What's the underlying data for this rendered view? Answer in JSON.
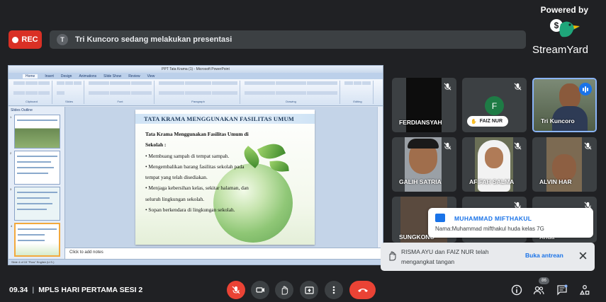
{
  "branding": {
    "powered_by": "Powered by",
    "logo_text": "StreamYard"
  },
  "recording": {
    "label": "REC"
  },
  "presenting": {
    "avatar_letter": "T",
    "text": "Tri Kuncoro sedang melakukan presentasi"
  },
  "ppt": {
    "window_title": "PPT Tata Krama (1) - Microsoft PowerPoint",
    "tabs": [
      "Home",
      "Insert",
      "Design",
      "Animations",
      "Slide Show",
      "Review",
      "View"
    ],
    "ribbon_groups": [
      "Clipboard",
      "Slides",
      "Font",
      "Paragraph",
      "Drawing",
      "Editing"
    ],
    "side_tabs": "Slides  Outline",
    "thumb_numbers": [
      "1",
      "2",
      "3",
      "4"
    ],
    "notes_placeholder": "Click to add notes",
    "status": "Slide 4 of 15   \"Flow\"   English (U.S.)"
  },
  "slide": {
    "title": "TATA KRAMA MENGGUNAKAN FASILITAS UMUM",
    "heading_1": "Tata Krama Menggunakan Fasilitas Umum di",
    "heading_2": "Sekolah :",
    "bullets": [
      "• Membuang sampah di tempat sampah.",
      "• Mengembalikan barang fasilitas sekolah pada",
      "tempat yang telah disediakan.",
      "• Menjaga kebersihan kelas, sekitar halaman, dan",
      "seluruh lingkungan sekolah.",
      "• Sopan berkendara di lingkungan sekolah."
    ]
  },
  "participants": [
    {
      "name": "FERDIANSYAH",
      "muted": true
    },
    {
      "name": "FAIZ NUR",
      "avatar": "F",
      "muted": true,
      "hand_raised": true
    },
    {
      "name": "Tri Kuncoro",
      "speaking": true
    },
    {
      "name": "GALIH SATRIA",
      "muted": true
    },
    {
      "name": "AFIFAH SALMA",
      "muted": true
    },
    {
      "name": "ALVIN HAR",
      "muted": true
    },
    {
      "name": "SUNGKONO",
      "muted": true
    },
    {
      "name": "",
      "muted": true
    },
    {
      "name": "Anda",
      "muted": true
    }
  ],
  "chat": {
    "from": "MUHAMMAD MIFTHAKUL",
    "message": "Nama:Muhammad mifthakul huda kelas 7G"
  },
  "raise_hand": {
    "text_1": "RISMA AYU dan FAIZ NUR telah",
    "text_2": "mengangkat tangan",
    "button": "Buka antrean"
  },
  "bottom": {
    "time": "09.34",
    "meeting_name": "MPLS HARI PERTAMA SESI 2",
    "participant_count": "86"
  },
  "colors": {
    "rec": "#d93025",
    "accent": "#1a73e8",
    "end_call": "#ea4335",
    "bg": "#202124",
    "tile": "#3c4043"
  }
}
